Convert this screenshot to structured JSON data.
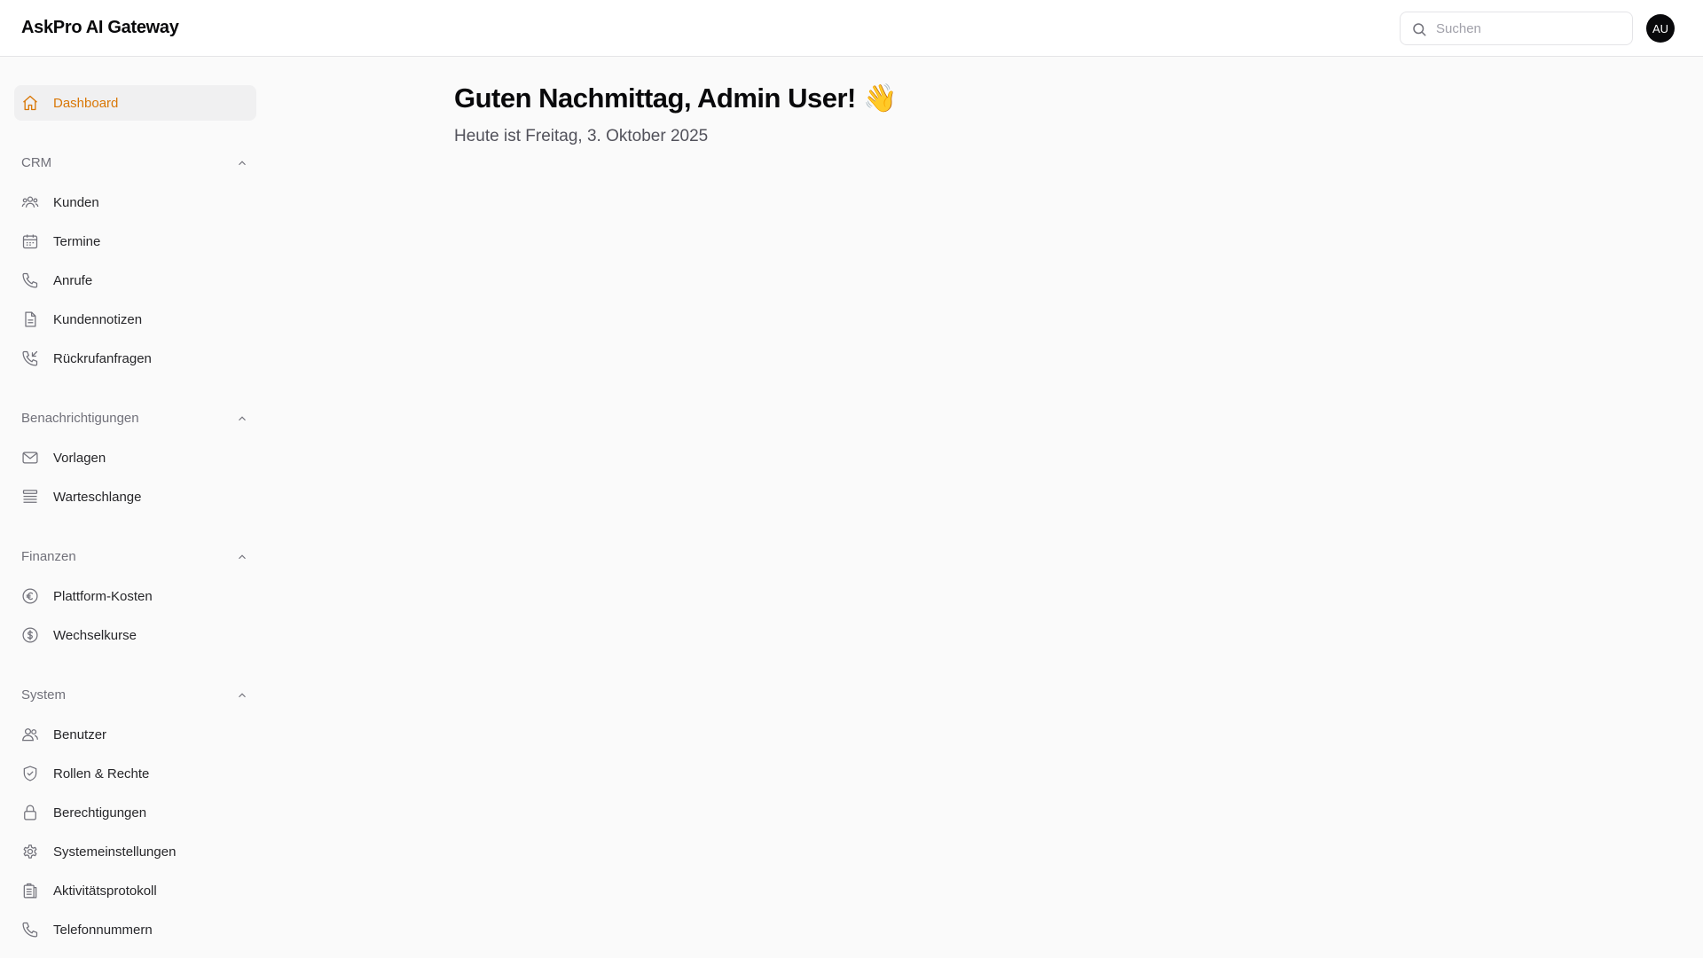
{
  "header": {
    "brand": "AskPro AI Gateway",
    "search_placeholder": "Suchen",
    "avatar_initials": "AU"
  },
  "sidebar": {
    "dashboard": {
      "label": "Dashboard",
      "icon": "home-icon"
    },
    "groups": [
      {
        "label": "CRM",
        "items": [
          {
            "label": "Kunden",
            "icon": "users-group-icon"
          },
          {
            "label": "Termine",
            "icon": "calendar-icon"
          },
          {
            "label": "Anrufe",
            "icon": "phone-icon"
          },
          {
            "label": "Kundennotizen",
            "icon": "document-icon"
          },
          {
            "label": "Rückrufanfragen",
            "icon": "phone-incoming-icon"
          }
        ]
      },
      {
        "label": "Benachrichtigungen",
        "items": [
          {
            "label": "Vorlagen",
            "icon": "envelope-icon"
          },
          {
            "label": "Warteschlange",
            "icon": "queue-list-icon"
          }
        ]
      },
      {
        "label": "Finanzen",
        "items": [
          {
            "label": "Plattform-Kosten",
            "icon": "euro-icon"
          },
          {
            "label": "Wechselkurse",
            "icon": "dollar-icon"
          }
        ]
      },
      {
        "label": "System",
        "items": [
          {
            "label": "Benutzer",
            "icon": "users-icon"
          },
          {
            "label": "Rollen & Rechte",
            "icon": "shield-check-icon"
          },
          {
            "label": "Berechtigungen",
            "icon": "lock-icon"
          },
          {
            "label": "Systemeinstellungen",
            "icon": "gear-icon"
          },
          {
            "label": "Aktivitätsprotokoll",
            "icon": "clipboard-icon"
          },
          {
            "label": "Telefonnummern",
            "icon": "phone-icon"
          }
        ]
      }
    ]
  },
  "main": {
    "greeting": "Guten Nachmittag, Admin User! 👋",
    "date_line": "Heute ist Freitag, 3. Oktober 2025"
  },
  "colors": {
    "accent": "#d97706",
    "sidebar_active_bg": "#f0f0f1",
    "page_bg": "#fafafa"
  }
}
